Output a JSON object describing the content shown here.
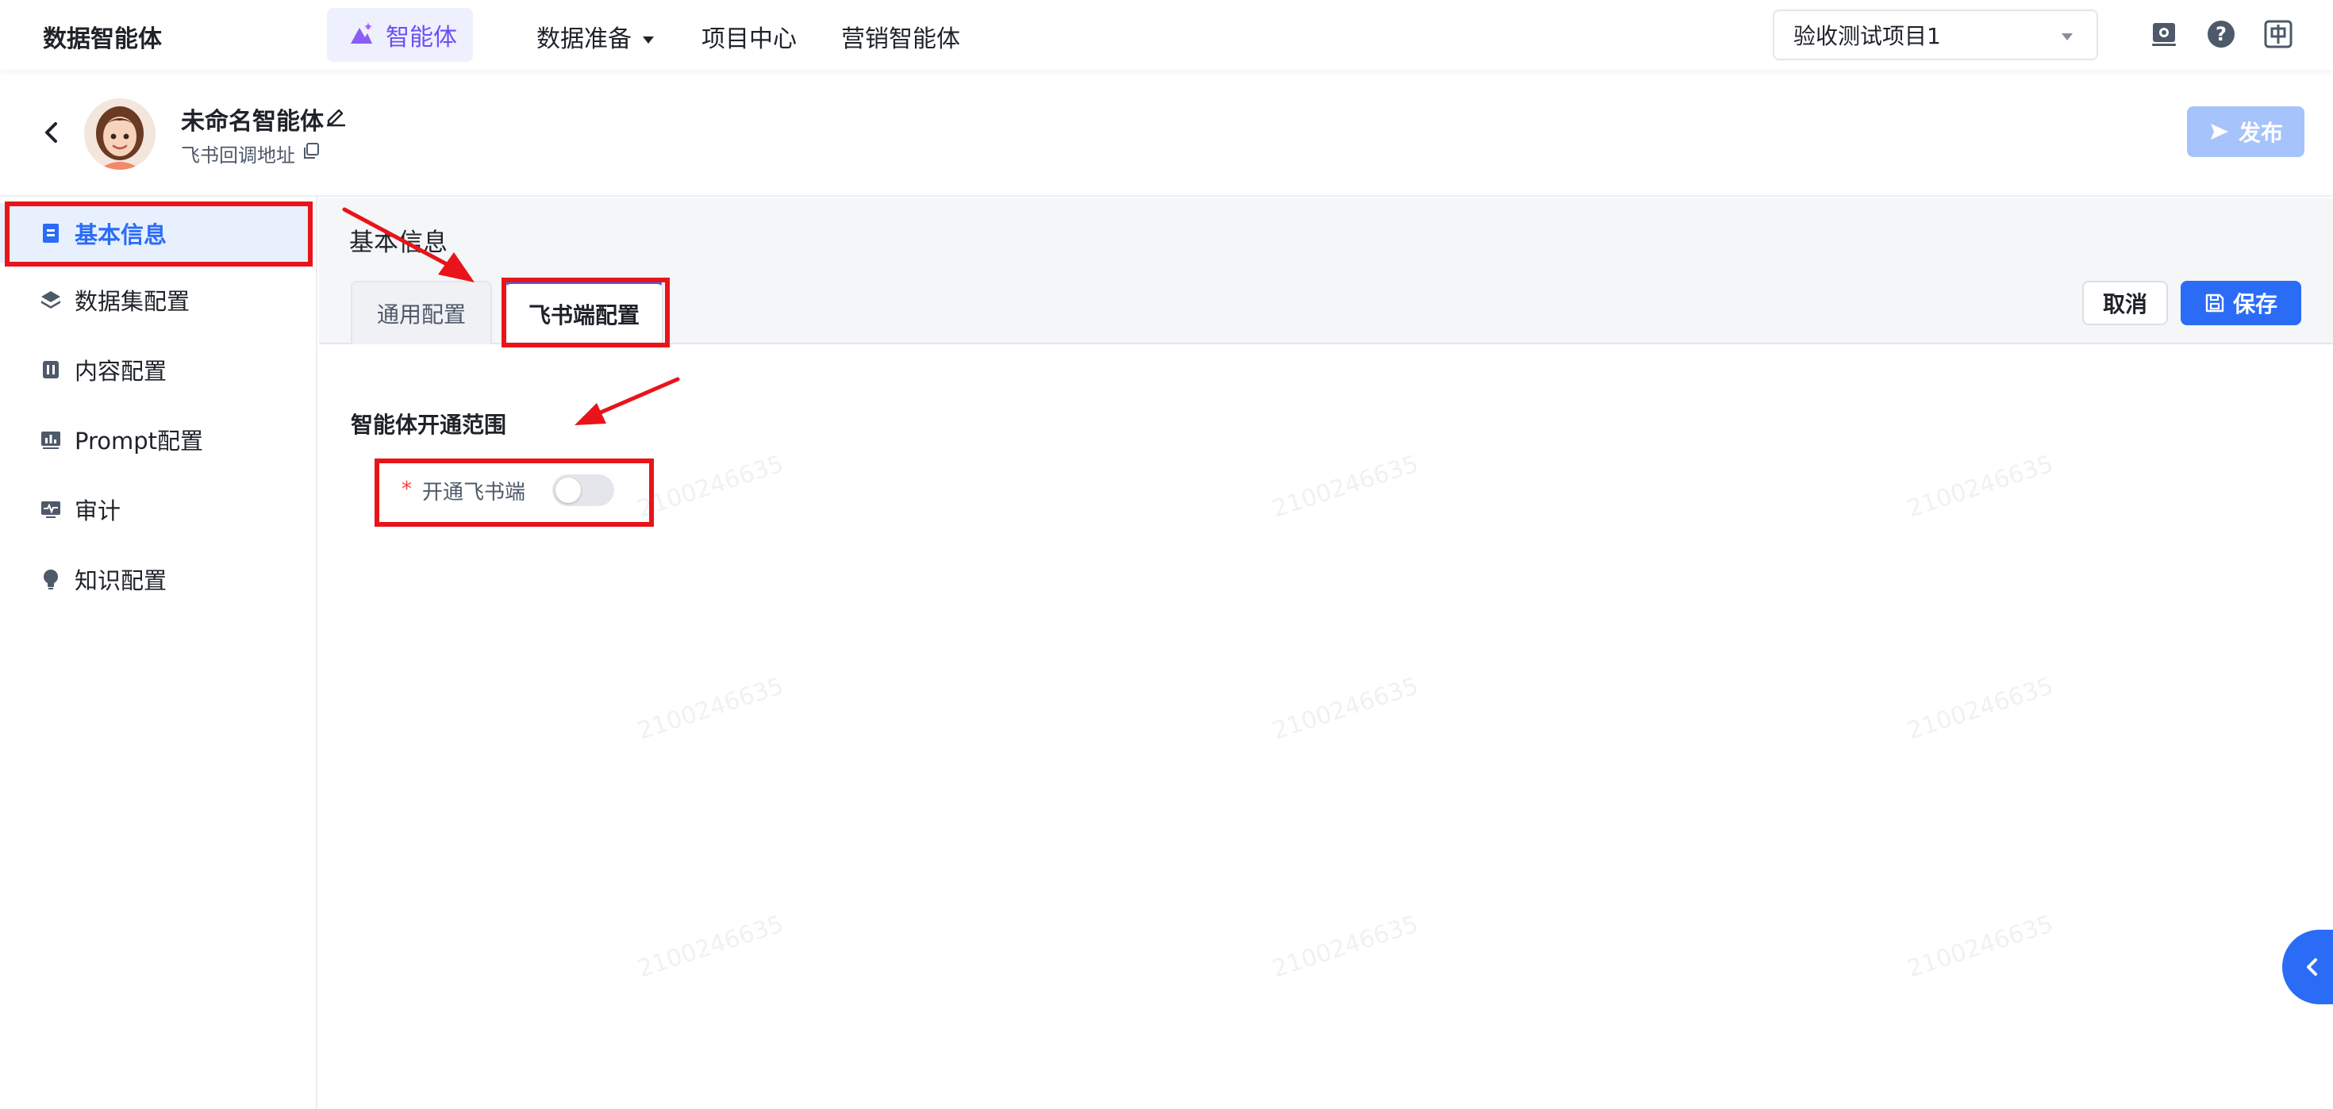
{
  "topnav": {
    "brand": "数据智能体",
    "active_item": "智能体",
    "items": [
      "数据准备",
      "项目中心",
      "营销智能体"
    ],
    "project_select": "验收测试项目1",
    "icons": [
      "settings-icon",
      "help-icon",
      "language-icon"
    ]
  },
  "header": {
    "agent_name": "未命名智能体",
    "callback_label": "飞书回调地址",
    "publish_label": "发布"
  },
  "sidebar": {
    "items": [
      {
        "label": "基本信息",
        "icon": "document-icon",
        "active": true
      },
      {
        "label": "数据集配置",
        "icon": "layers-icon",
        "active": false
      },
      {
        "label": "内容配置",
        "icon": "content-icon",
        "active": false
      },
      {
        "label": "Prompt配置",
        "icon": "chart-icon",
        "active": false
      },
      {
        "label": "审计",
        "icon": "monitor-icon",
        "active": false
      },
      {
        "label": "知识配置",
        "icon": "bulb-icon",
        "active": false
      }
    ]
  },
  "content": {
    "section_title": "基本信息",
    "tabs": [
      {
        "label": "通用配置",
        "active": false
      },
      {
        "label": "飞书端配置",
        "active": true
      }
    ],
    "cancel_label": "取消",
    "save_label": "保存",
    "scope_title": "智能体开通范围",
    "required_mark": "*",
    "field_label": "开通飞书端",
    "toggle_on": false
  },
  "watermark": "2100246635",
  "colors": {
    "accent": "#2b6cf6",
    "active_nav_text": "#6b4ff5",
    "annotation_red": "#e8141a",
    "publish_disabled": "#a7c3fb"
  }
}
